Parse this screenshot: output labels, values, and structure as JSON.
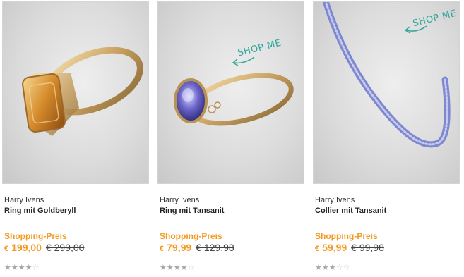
{
  "products": [
    {
      "brand": "Harry Ivens",
      "name": "Ring mit Goldberyll",
      "price_label": "Shopping-Preis",
      "currency": "€",
      "price": "199,00",
      "old_price": "€ 299,00",
      "rating": 4,
      "rating_max": 5,
      "badge": ""
    },
    {
      "brand": "Harry Ivens",
      "name": "Ring mit Tansanit",
      "price_label": "Shopping-Preis",
      "currency": "€",
      "price": "79,99",
      "old_price": "€ 129,98",
      "rating": 4,
      "rating_max": 5,
      "badge": "SHOP ME"
    },
    {
      "brand": "Harry Ivens",
      "name": "Collier mit Tansanit",
      "price_label": "Shopping-Preis",
      "currency": "€",
      "price": "59,99",
      "old_price": "€ 99,98",
      "rating": 3,
      "rating_max": 5,
      "badge": "SHOP ME"
    }
  ],
  "colors": {
    "accent": "#f39a22",
    "badge": "#2fa79a",
    "star_on": "#a8a8a8",
    "star_off": "#cfcfcf"
  }
}
